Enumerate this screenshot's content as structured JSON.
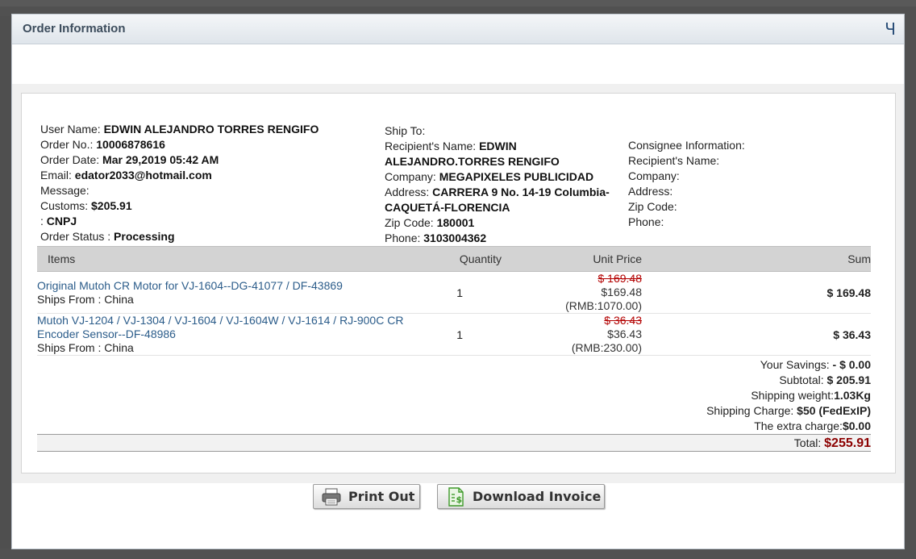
{
  "dialog": {
    "title": "Order Information",
    "close_glyph": "Ч"
  },
  "order": {
    "user_name_label": "User Name:",
    "user_name": "EDWIN ALEJANDRO TORRES RENGIFO",
    "order_no_label": "Order No.:",
    "order_no": "10006878616",
    "order_date_label": "Order Date:",
    "order_date": "Mar 29,2019 05:42 AM",
    "email_label": "Email:",
    "email": "edator2033@hotmail.com",
    "message_label": "Message:",
    "customs_label": "Customs:",
    "customs": "$205.91",
    "cnpj_label": ":",
    "cnpj": "CNPJ",
    "status_label": "Order Status :",
    "status": "Processing"
  },
  "ship_to": {
    "heading": "Ship To:",
    "recipient_label": "Recipient's Name:",
    "recipient": "EDWIN ALEJANDRO.TORRES RENGIFO",
    "company_label": "Company:",
    "company": "MEGAPIXELES PUBLICIDAD",
    "address_label": "Address:",
    "address": "CARRERA 9 No. 14-19 Columbia-CAQUETÁ-FLORENCIA",
    "zip_label": "Zip Code:",
    "zip": "180001",
    "phone_label": "Phone:",
    "phone": "3103004362"
  },
  "consignee": {
    "heading": "Consignee Information:",
    "recipient_label": "Recipient's Name:",
    "company_label": "Company:",
    "address_label": "Address:",
    "zip_label": "Zip Code:",
    "phone_label": "Phone:"
  },
  "table": {
    "headers": {
      "items": "Items",
      "quantity": "Quantity",
      "unit_price": "Unit Price",
      "sum": "Sum"
    },
    "rows": [
      {
        "name": "Original Mutoh CR Motor for VJ-1604--DG-41077 / DF-43869",
        "ships": "Ships From : China",
        "qty": "1",
        "old_price": "$ 169.48",
        "price": "$169.48",
        "rmb": "(RMB:1070.00)",
        "sum": "$ 169.48"
      },
      {
        "name": "Mutoh VJ-1204 / VJ-1304 / VJ-1604 / VJ-1604W / VJ-1614 / RJ-900C CR Encoder Sensor--DF-48986",
        "ships": "Ships From : China",
        "qty": "1",
        "old_price": "$ 36.43",
        "price": "$36.43",
        "rmb": "(RMB:230.00)",
        "sum": "$ 36.43"
      }
    ]
  },
  "totals": {
    "savings_label": "Your Savings:",
    "savings": "- $ 0.00",
    "subtotal_label": "Subtotal:",
    "subtotal": "$ 205.91",
    "weight_label": "Shipping weight:",
    "weight": "1.03Kg",
    "shipping_label": "Shipping Charge:",
    "shipping": "$50 (FedExIP)",
    "extra_label": "The extra charge:",
    "extra": "$0.00",
    "total_label": "Total:",
    "total": "$255.91"
  },
  "buttons": {
    "print": "Print Out",
    "invoice": "Download Invoice"
  },
  "colors": {
    "accent_red": "#8b0000",
    "link": "#2b5c8a"
  },
  "icons": {
    "close": "close-icon",
    "print": "printer-icon",
    "invoice": "invoice-icon"
  }
}
